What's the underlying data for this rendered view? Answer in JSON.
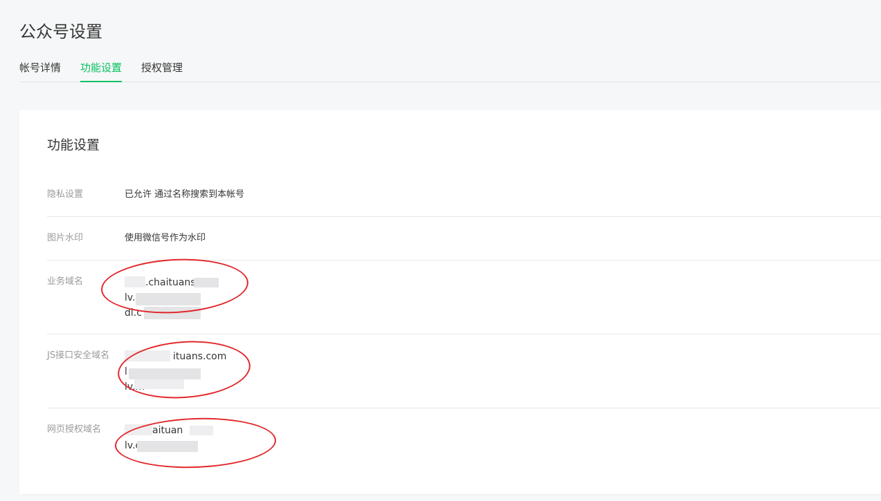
{
  "header": {
    "title": "公众号设置"
  },
  "tabs": [
    {
      "label": "帐号详情",
      "active": false
    },
    {
      "label": "功能设置",
      "active": true
    },
    {
      "label": "授权管理",
      "active": false
    }
  ],
  "section": {
    "title": "功能设置",
    "rows": [
      {
        "label": "隐私设置",
        "value": "已允许 通过名称搜索到本帐号"
      },
      {
        "label": "图片水印",
        "value": "使用微信号作为水印"
      },
      {
        "label": "业务域名",
        "domains": [
          "mall.chaituans.com",
          "lv.c",
          "dl.c"
        ]
      },
      {
        "label": "JS接口安全域名",
        "domains": [
          "ituans.com",
          "l",
          "lv.m"
        ]
      },
      {
        "label": "网页授权域名",
        "domains": [
          "aituan",
          "lv.c"
        ]
      }
    ]
  },
  "colors": {
    "accent": "#07c160",
    "annotation": "#e2262a",
    "label_gray": "#9a9a9a"
  }
}
